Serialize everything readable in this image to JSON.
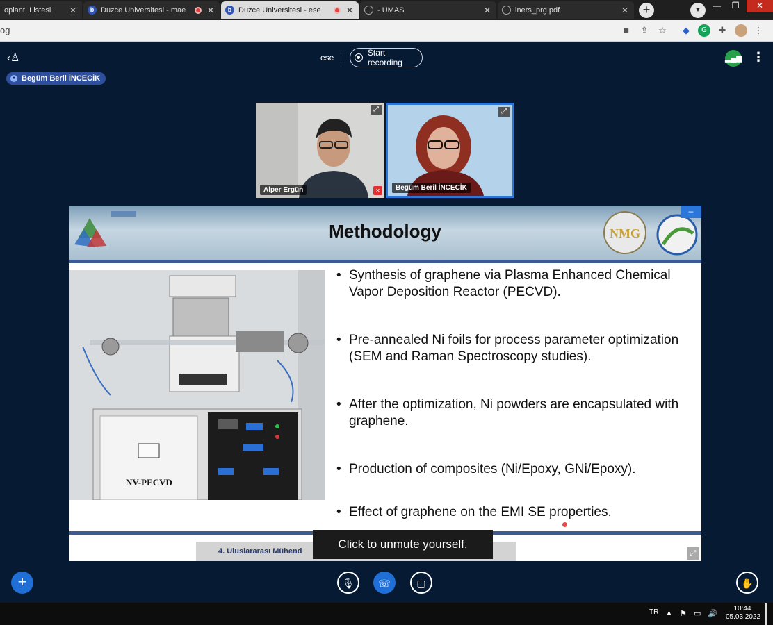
{
  "browser": {
    "tabs": [
      {
        "title": "oplantı Listesi",
        "active": false,
        "recording": false
      },
      {
        "title": "Duzce Universitesi - mae",
        "active": false,
        "recording": true
      },
      {
        "title": "Duzce Universitesi - ese",
        "active": true,
        "recording": true
      },
      {
        "title": "- UMAS",
        "active": false,
        "recording": false
      },
      {
        "title": "iners_prg.pdf",
        "active": false,
        "recording": false
      }
    ],
    "new_tab": "+",
    "url": "og",
    "window_controls": [
      "—",
      "❐",
      "✕"
    ]
  },
  "meeting": {
    "speaker_chip": "Begüm Beril İNCECİK",
    "name": "ese",
    "record_label": "Start recording",
    "participants": [
      {
        "name": "Alper Ergün",
        "muted": true
      },
      {
        "name": "Begüm Beril İNCECİK",
        "muted": false
      }
    ],
    "toast": "Click   to unmute yourself.",
    "controls": {
      "add": "+",
      "mic": "🎙",
      "phone": "☏",
      "camera": "▢",
      "hand": "✋"
    }
  },
  "slide": {
    "title": "Methodology",
    "minimize": "–",
    "photo_label": "NV-PECVD",
    "bullets": [
      "Synthesis of graphene via Plasma Enhanced Chemical Vapor Deposition Reactor (PECVD).",
      "Pre-annealed Ni foils for process parameter optimization (SEM and Raman Spectroscopy studies).",
      "After the optimization, Ni powders are encapsulated with graphene.",
      "Production of composites (Ni/Epoxy, GNi/Epoxy).",
      "Effect of graphene on the EMI SE properties."
    ],
    "footer": "4. Uluslararası Mühend"
  },
  "taskbar": {
    "language": "TR",
    "time": "10:44",
    "date": "05.03.2022"
  }
}
